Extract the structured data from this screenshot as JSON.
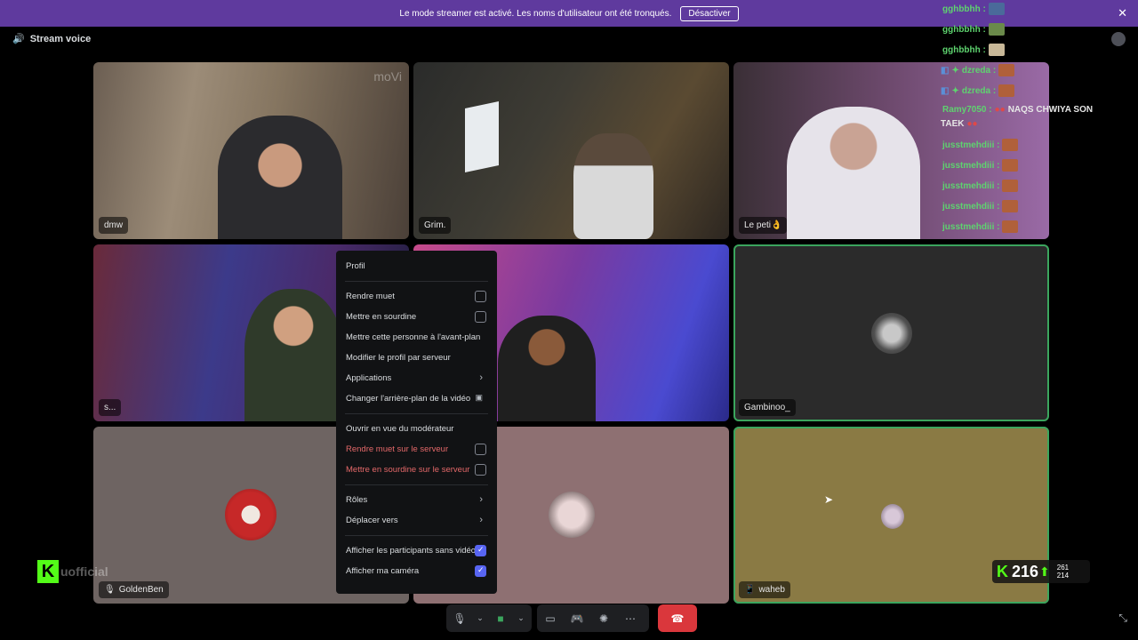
{
  "banner": {
    "text": "Le mode streamer est activé. Les noms d'utilisateur ont été tronqués.",
    "button": "Désactiver"
  },
  "header": {
    "title": "Stream voice"
  },
  "tiles": [
    {
      "name": "dmw"
    },
    {
      "name": "Grim."
    },
    {
      "name": "Le peti👌"
    },
    {
      "name": "s..."
    },
    {
      "name": ""
    },
    {
      "name": "Gambinoo_"
    },
    {
      "name": "GoldenBen"
    },
    {
      "name": ""
    },
    {
      "name": "waheb"
    }
  ],
  "watermark": "moVi",
  "context_menu": {
    "items": [
      {
        "label": "Profil"
      },
      {
        "label": "Rendre muet"
      },
      {
        "label": "Mettre en sourdine"
      },
      {
        "label": "Mettre cette personne à l'avant-plan"
      },
      {
        "label": "Modifier le profil par serveur"
      },
      {
        "label": "Applications"
      },
      {
        "label": "Changer l'arrière-plan de la vidéo"
      },
      {
        "label": "Ouvrir en vue du modérateur"
      },
      {
        "label": "Rendre muet sur le serveur"
      },
      {
        "label": "Mettre en sourdine sur le serveur"
      },
      {
        "label": "Rôles"
      },
      {
        "label": "Déplacer vers"
      },
      {
        "label": "Afficher les participants sans vidéo"
      },
      {
        "label": "Afficher ma caméra"
      }
    ]
  },
  "chat": [
    {
      "user": "gghbbhh :",
      "msg": ""
    },
    {
      "user": "gghbbhh :",
      "msg": ""
    },
    {
      "user": "gghbbhh :",
      "msg": ""
    },
    {
      "user": "dzreda :",
      "msg": ""
    },
    {
      "user": "dzreda :",
      "msg": ""
    },
    {
      "user": "Ramy7050 :",
      "msg": "NAQS CHWIYA SON"
    },
    {
      "user": "",
      "msg": "TAEK"
    },
    {
      "user": "jusstmehdiii :",
      "msg": ""
    },
    {
      "user": "jusstmehdiii :",
      "msg": ""
    },
    {
      "user": "jusstmehdiii :",
      "msg": ""
    },
    {
      "user": "jusstmehdiii :",
      "msg": ""
    },
    {
      "user": "jusstmehdiii :",
      "msg": ""
    }
  ],
  "kick_overlay": {
    "count": "216",
    "stat_up": "261",
    "stat_down": "214",
    "handle": "uofficial"
  },
  "colors": {
    "accent": "#5865f2",
    "live_green": "#3ba55d",
    "banner": "#5f3a9e",
    "hangup": "#da373c"
  }
}
